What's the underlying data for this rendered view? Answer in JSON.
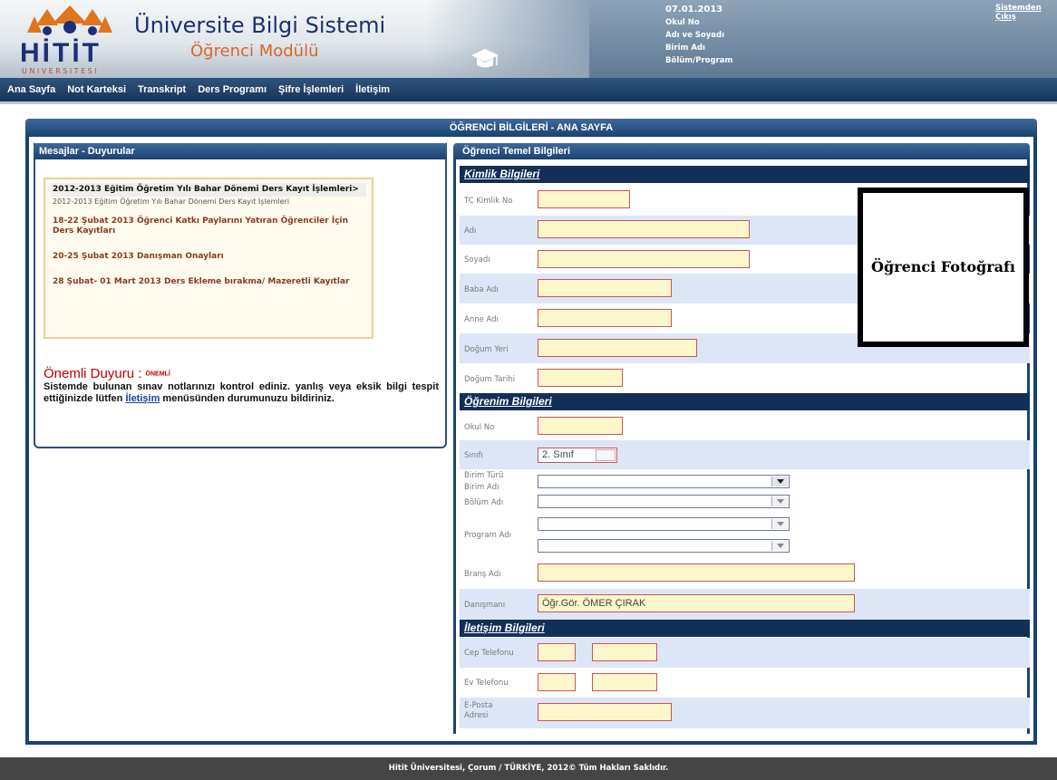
{
  "header": {
    "logo_text": "HİTİT",
    "logo_sub": "UNIVERSITESI",
    "app_title": "Üniversite Bilgi Sistemi",
    "app_subtitle": "Öğrenci Modülü",
    "date": "07.01.2013",
    "info_lines": [
      "Okul No",
      "Adı ve Soyadı",
      "Birim Adı",
      "Bölüm/Program"
    ],
    "logout_label": "Sistemden Çıkış"
  },
  "menu": [
    "Ana Sayfa",
    "Not Karteksi",
    "Transkript",
    "Ders Programı",
    "Şifre İşlemleri",
    "İletişim"
  ],
  "main_title": "ÖĞRENCİ BİLGİLERİ - ANA SAYFA",
  "messages": {
    "title": "Mesajlar - Duyurular",
    "main_item": "2012-2013 Eğitim Öğretim Yılı Bahar Dönemi Ders Kayıt İşlemleri>",
    "main_sub": "2012-2013 Eğitim Öğretim Yılı Bahar Dönemi Ders Kayıt İşlemleri",
    "items": [
      "18-22 Şubat 2013  Öğrenci Katkı Paylarını Yatıran Öğrenciler İçin Ders Kayıtları",
      "20-25 Şubat 2013  Danışman Onayları",
      "28 Şubat- 01 Mart 2013  Ders Ekleme bırakma/ Mazeretli Kayıtlar"
    ],
    "important_title": "Önemli Duyuru : ",
    "important_badge": "ÖNEMLİ",
    "important_text": "Sistemde bulunan sınav notlarınızı kontrol ediniz. yanlış veya eksik bilgi tespit ettiğinizde lütfen ",
    "important_link": "İletişim",
    "important_text_end": " menüsünden durumunuzu bildiriniz."
  },
  "student": {
    "title": "Öğrenci Temel Bilgileri",
    "identity_title": "Kimlik Bilgileri",
    "identity_labels": [
      "TC Kimlik No",
      "Adı",
      "Soyadı",
      "Baba Adı",
      "Anne Adı",
      "Doğum Yeri",
      "Doğum Tarihi"
    ],
    "photo_label": "Öğrenci Fotoğrafı",
    "education_title": "Öğrenim Bilgileri",
    "school_no_label": "Okul No",
    "class_label": "Sınıfı",
    "class_value": "2. Sınıf",
    "unit_type_label": "Birim Türü",
    "unit_name_label": "Birim Adı",
    "department_label": "Bölüm Adı",
    "program_label": "Program Adı",
    "branch_label": "Branş Adı",
    "advisor_label": "Danışmanı",
    "advisor_value": "Öğr.Gör. ÖMER ÇIRAK",
    "contact_title": "İletişim Bilgileri",
    "mobile_label": "Cep Telefonu",
    "home_label": "Ev Telefonu",
    "email_label": "E-Posta Adresi"
  },
  "footer": "Hitit Üniversitesi, Çorum / TÜRKİYE, 2012© Tüm Hakları Saklıdır."
}
